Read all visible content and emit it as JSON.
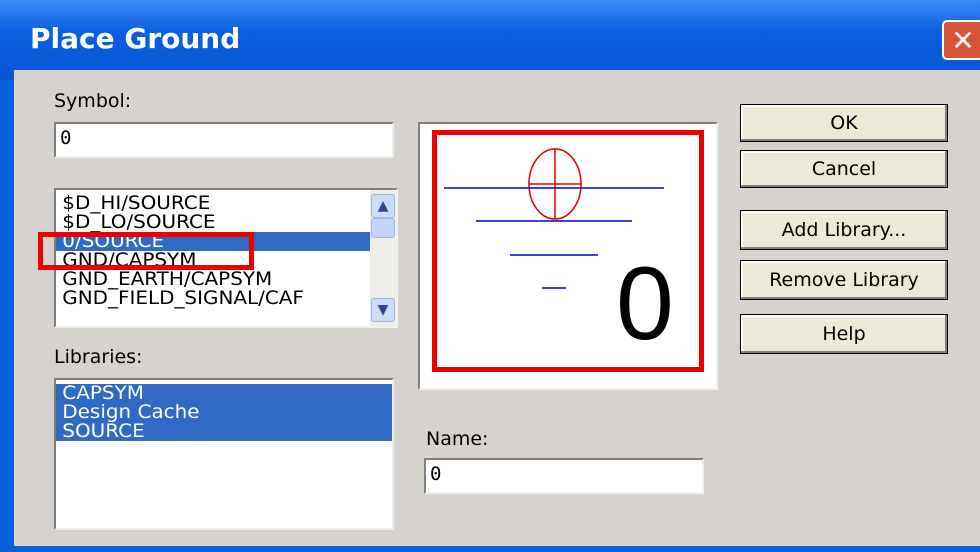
{
  "window": {
    "title": "Place Ground",
    "close_glyph": "✕"
  },
  "symbol": {
    "label": "Symbol:",
    "label_underline": "S",
    "value": "0",
    "list_items": [
      "$D_HI/SOURCE",
      "$D_LO/SOURCE",
      "0/SOURCE",
      "GND/CAPSYM",
      "GND_EARTH/CAPSYM",
      "GND_FIELD_SIGNAL/CAF"
    ],
    "selected_item": "0/SOURCE"
  },
  "libraries": {
    "label": "Libraries:",
    "items": [
      "CAPSYM",
      "Design Cache",
      "SOURCE"
    ]
  },
  "preview": {
    "big_label": "0"
  },
  "name": {
    "label": "Name:",
    "value": "0"
  },
  "buttons": {
    "ok": "OK",
    "cancel": "Cancel",
    "add_library": "Add Library...",
    "remove_library": "Remove Library",
    "help": "Help"
  },
  "colors": {
    "title_bar": "#0a55d0",
    "selection": "#316ac5",
    "highlight_box": "#ee0000",
    "symbol_lines": "#0000cc",
    "symbol_circle": "#dd0000"
  }
}
